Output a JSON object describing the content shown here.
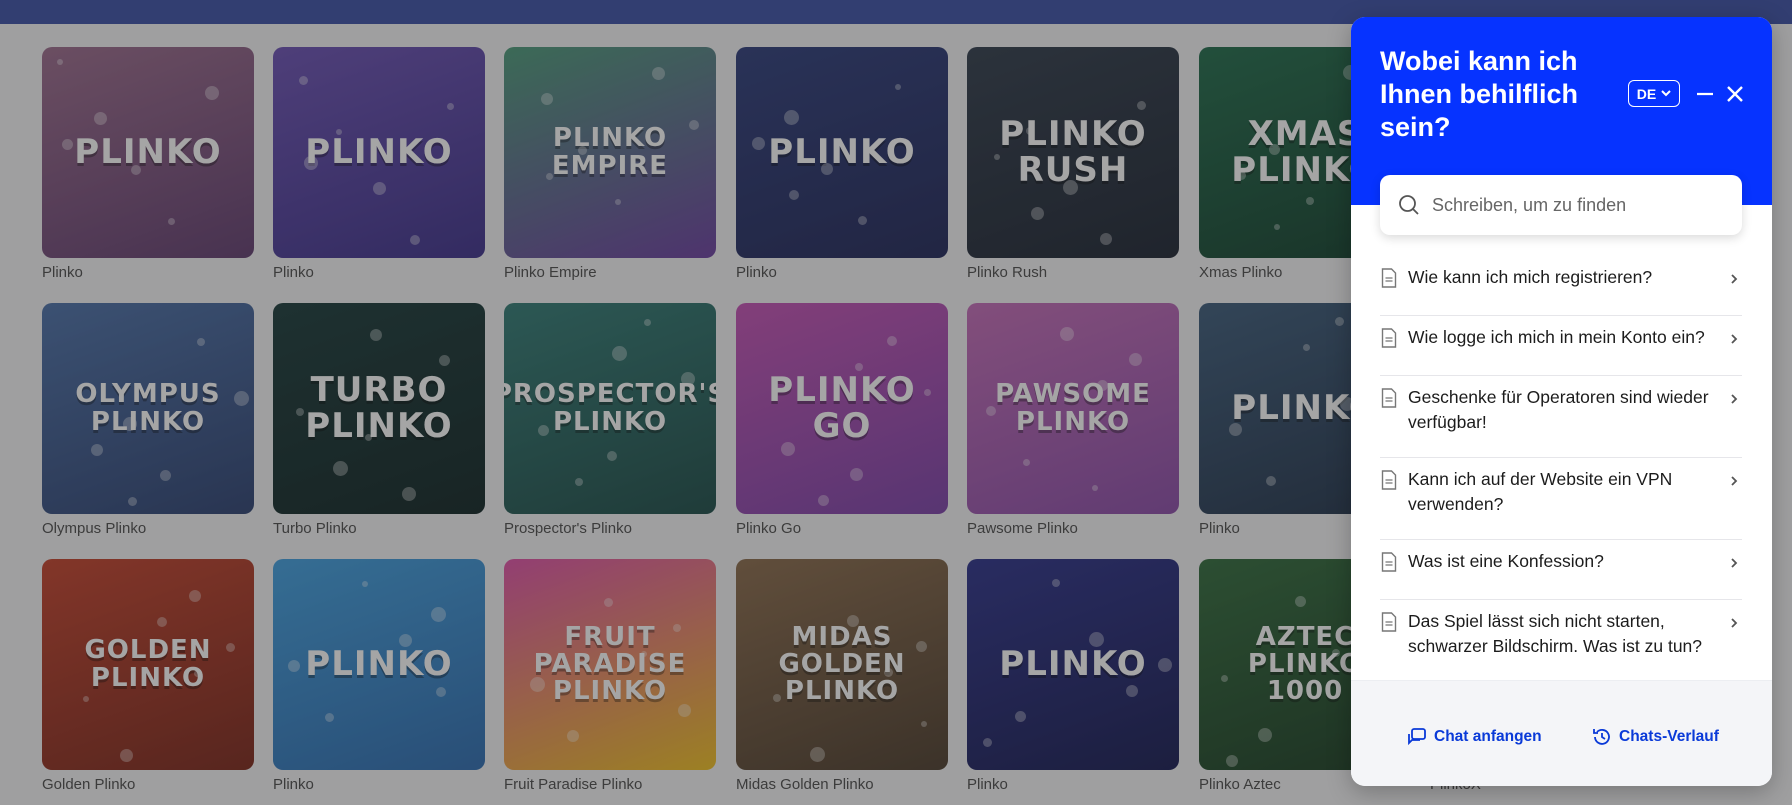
{
  "games": [
    {
      "name": "Plinko",
      "thumb": "PLINKO",
      "bg": "#9b6a8c",
      "bg2": "#5f3a6e"
    },
    {
      "name": "Plinko",
      "thumb": "PLINKO",
      "bg": "#6a4fb4",
      "bg2": "#3b2e8a"
    },
    {
      "name": "Plinko Empire",
      "thumb": "PLINKO EMPIRE",
      "bg": "#4a9a78",
      "bg2": "#6a3ca0"
    },
    {
      "name": "Plinko",
      "thumb": "PLINKO",
      "bg": "#2b3a7a",
      "bg2": "#1d2457"
    },
    {
      "name": "Plinko Rush",
      "thumb": "PLINKO RUSH",
      "bg": "#2e3a4a",
      "bg2": "#1a2230"
    },
    {
      "name": "Xmas Plinko",
      "thumb": "XMAS PLINKO",
      "bg": "#1f6b4a",
      "bg2": "#0f3d2a"
    },
    {
      "name": "Olympus Plinko",
      "thumb": "OLYMPUS PLINKO",
      "bg": "#4a6fa8",
      "bg2": "#2a3f70"
    },
    {
      "name": "Turbo Plinko",
      "thumb": "TURBO PLINKO",
      "bg": "#173838",
      "bg2": "#0d2222"
    },
    {
      "name": "Prospector's Plinko",
      "thumb": "PROSPECTOR'S PLINKO",
      "bg": "#2f7a74",
      "bg2": "#1a4a46"
    },
    {
      "name": "Plinko Go",
      "thumb": "PLINKO GO",
      "bg": "#c44fb4",
      "bg2": "#7a3fa8"
    },
    {
      "name": "Pawsome Plinko",
      "thumb": "PAWSOME PLINKO",
      "bg": "#c46ab8",
      "bg2": "#8a4aa8"
    },
    {
      "name": "Plinko",
      "thumb": "PLINKO",
      "bg": "#3a5a7a",
      "bg2": "#1f3048"
    },
    {
      "name": "Golden Plinko",
      "thumb": "GOLDEN PLINKO",
      "bg": "#c4402a",
      "bg2": "#7a2418"
    },
    {
      "name": "Plinko",
      "thumb": "PLINKO",
      "bg": "#3f9fe0",
      "bg2": "#2a6ab0"
    },
    {
      "name": "Fruit Paradise Plinko",
      "thumb": "FRUIT PARADISE PLINKO",
      "bg": "#e04fa8",
      "bg2": "#f0c020"
    },
    {
      "name": "Midas Golden Plinko",
      "thumb": "MIDAS GOLDEN PLINKO",
      "bg": "#8a6a4a",
      "bg2": "#4a3a2a"
    },
    {
      "name": "Plinko",
      "thumb": "PLINKO",
      "bg": "#2a2f8a",
      "bg2": "#141850"
    },
    {
      "name": "Plinko Aztec",
      "thumb": "AZTEC PLINKO 1000",
      "bg": "#2f6a3a",
      "bg2": "#173a20"
    },
    {
      "name": "PlinkoX",
      "thumb": "",
      "bg": "#cccccc",
      "bg2": "#cccccc"
    }
  ],
  "widget": {
    "title": "Wobei kann ich Ihnen behilflich sein?",
    "language": "DE",
    "search_placeholder": "Schreiben, um zu finden",
    "faq": [
      "Wie kann ich mich registrieren?",
      "Wie logge ich mich in mein Konto ein?",
      "Geschenke für Operatoren sind wieder verfügbar!",
      "Kann ich auf der Website ein VPN verwenden?",
      "Was ist eine Konfession?",
      "Das Spiel lässt sich nicht starten, schwarzer Bildschirm. Was ist zu tun?"
    ],
    "start_chat": "Chat anfangen",
    "chat_history": "Chats-Verlauf"
  },
  "colors": {
    "header_blue": "#0633ff",
    "link_blue": "#0a3ad8",
    "topbar": "#3a4fa5"
  }
}
